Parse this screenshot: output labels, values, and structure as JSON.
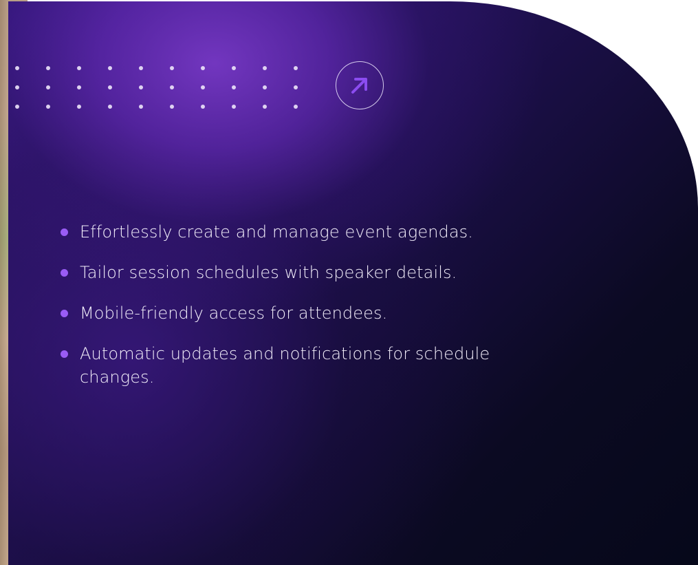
{
  "theme": {
    "accent": "#8b4cf0",
    "bullet_color": "#9a5cf5",
    "text_color": "#f3effb"
  },
  "cta": {
    "icon": "arrow-up-right-icon"
  },
  "features": [
    "Effortlessly create and manage event agendas.",
    "Tailor session schedules with speaker details.",
    "Mobile-friendly access for attendees.",
    "Automatic updates and notifications for schedule changes."
  ]
}
